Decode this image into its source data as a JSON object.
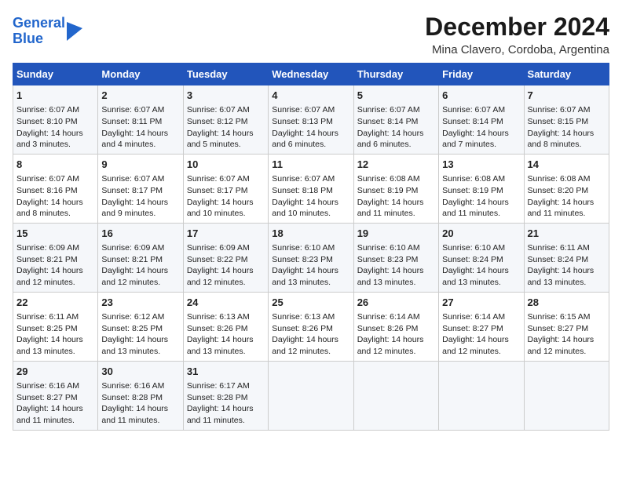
{
  "header": {
    "logo_line1": "General",
    "logo_line2": "Blue",
    "title": "December 2024",
    "subtitle": "Mina Clavero, Cordoba, Argentina"
  },
  "columns": [
    "Sunday",
    "Monday",
    "Tuesday",
    "Wednesday",
    "Thursday",
    "Friday",
    "Saturday"
  ],
  "weeks": [
    [
      {
        "day": "1",
        "info": "Sunrise: 6:07 AM\nSunset: 8:10 PM\nDaylight: 14 hours and 3 minutes."
      },
      {
        "day": "2",
        "info": "Sunrise: 6:07 AM\nSunset: 8:11 PM\nDaylight: 14 hours and 4 minutes."
      },
      {
        "day": "3",
        "info": "Sunrise: 6:07 AM\nSunset: 8:12 PM\nDaylight: 14 hours and 5 minutes."
      },
      {
        "day": "4",
        "info": "Sunrise: 6:07 AM\nSunset: 8:13 PM\nDaylight: 14 hours and 6 minutes."
      },
      {
        "day": "5",
        "info": "Sunrise: 6:07 AM\nSunset: 8:14 PM\nDaylight: 14 hours and 6 minutes."
      },
      {
        "day": "6",
        "info": "Sunrise: 6:07 AM\nSunset: 8:14 PM\nDaylight: 14 hours and 7 minutes."
      },
      {
        "day": "7",
        "info": "Sunrise: 6:07 AM\nSunset: 8:15 PM\nDaylight: 14 hours and 8 minutes."
      }
    ],
    [
      {
        "day": "8",
        "info": "Sunrise: 6:07 AM\nSunset: 8:16 PM\nDaylight: 14 hours and 8 minutes."
      },
      {
        "day": "9",
        "info": "Sunrise: 6:07 AM\nSunset: 8:17 PM\nDaylight: 14 hours and 9 minutes."
      },
      {
        "day": "10",
        "info": "Sunrise: 6:07 AM\nSunset: 8:17 PM\nDaylight: 14 hours and 10 minutes."
      },
      {
        "day": "11",
        "info": "Sunrise: 6:07 AM\nSunset: 8:18 PM\nDaylight: 14 hours and 10 minutes."
      },
      {
        "day": "12",
        "info": "Sunrise: 6:08 AM\nSunset: 8:19 PM\nDaylight: 14 hours and 11 minutes."
      },
      {
        "day": "13",
        "info": "Sunrise: 6:08 AM\nSunset: 8:19 PM\nDaylight: 14 hours and 11 minutes."
      },
      {
        "day": "14",
        "info": "Sunrise: 6:08 AM\nSunset: 8:20 PM\nDaylight: 14 hours and 11 minutes."
      }
    ],
    [
      {
        "day": "15",
        "info": "Sunrise: 6:09 AM\nSunset: 8:21 PM\nDaylight: 14 hours and 12 minutes."
      },
      {
        "day": "16",
        "info": "Sunrise: 6:09 AM\nSunset: 8:21 PM\nDaylight: 14 hours and 12 minutes."
      },
      {
        "day": "17",
        "info": "Sunrise: 6:09 AM\nSunset: 8:22 PM\nDaylight: 14 hours and 12 minutes."
      },
      {
        "day": "18",
        "info": "Sunrise: 6:10 AM\nSunset: 8:23 PM\nDaylight: 14 hours and 13 minutes."
      },
      {
        "day": "19",
        "info": "Sunrise: 6:10 AM\nSunset: 8:23 PM\nDaylight: 14 hours and 13 minutes."
      },
      {
        "day": "20",
        "info": "Sunrise: 6:10 AM\nSunset: 8:24 PM\nDaylight: 14 hours and 13 minutes."
      },
      {
        "day": "21",
        "info": "Sunrise: 6:11 AM\nSunset: 8:24 PM\nDaylight: 14 hours and 13 minutes."
      }
    ],
    [
      {
        "day": "22",
        "info": "Sunrise: 6:11 AM\nSunset: 8:25 PM\nDaylight: 14 hours and 13 minutes."
      },
      {
        "day": "23",
        "info": "Sunrise: 6:12 AM\nSunset: 8:25 PM\nDaylight: 14 hours and 13 minutes."
      },
      {
        "day": "24",
        "info": "Sunrise: 6:13 AM\nSunset: 8:26 PM\nDaylight: 14 hours and 13 minutes."
      },
      {
        "day": "25",
        "info": "Sunrise: 6:13 AM\nSunset: 8:26 PM\nDaylight: 14 hours and 12 minutes."
      },
      {
        "day": "26",
        "info": "Sunrise: 6:14 AM\nSunset: 8:26 PM\nDaylight: 14 hours and 12 minutes."
      },
      {
        "day": "27",
        "info": "Sunrise: 6:14 AM\nSunset: 8:27 PM\nDaylight: 14 hours and 12 minutes."
      },
      {
        "day": "28",
        "info": "Sunrise: 6:15 AM\nSunset: 8:27 PM\nDaylight: 14 hours and 12 minutes."
      }
    ],
    [
      {
        "day": "29",
        "info": "Sunrise: 6:16 AM\nSunset: 8:27 PM\nDaylight: 14 hours and 11 minutes."
      },
      {
        "day": "30",
        "info": "Sunrise: 6:16 AM\nSunset: 8:28 PM\nDaylight: 14 hours and 11 minutes."
      },
      {
        "day": "31",
        "info": "Sunrise: 6:17 AM\nSunset: 8:28 PM\nDaylight: 14 hours and 11 minutes."
      },
      null,
      null,
      null,
      null
    ]
  ]
}
